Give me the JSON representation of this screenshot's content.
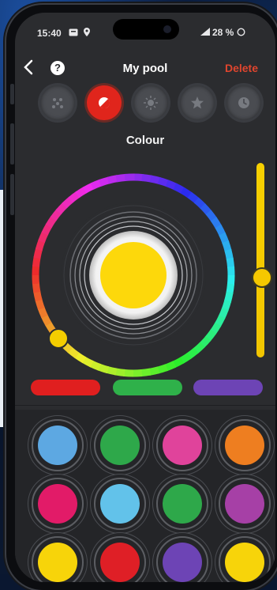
{
  "status": {
    "time": "15:40",
    "battery": "28 %"
  },
  "header": {
    "back_icon": "chevron-left-icon",
    "help_label": "?",
    "title": "My pool",
    "delete_label": "Delete"
  },
  "modes": [
    {
      "name": "sparkles-icon",
      "active": false
    },
    {
      "name": "colour-mode-icon",
      "active": true
    },
    {
      "name": "sun-icon",
      "active": false
    },
    {
      "name": "star-icon",
      "active": false
    },
    {
      "name": "clock-icon",
      "active": false
    }
  ],
  "section_title": "Colour",
  "wheel": {
    "selected_color": "#fdd80b",
    "knob_color": "#f4cd00"
  },
  "brightness": {
    "color": "#f5c800",
    "level": 0.5
  },
  "presets": [
    "#e01f1f",
    "#2fb14a",
    "#6d44b5"
  ],
  "swatches": [
    [
      "#5da8e2",
      "#2ea84a",
      "#e0439b",
      "#ee7e20"
    ],
    [
      "#e21b68",
      "#62c2ea",
      "#2ea84a",
      "#a640a6"
    ],
    [
      "#f7d40a",
      "#df1f26",
      "#6d44b5",
      "#f7d40a"
    ]
  ]
}
